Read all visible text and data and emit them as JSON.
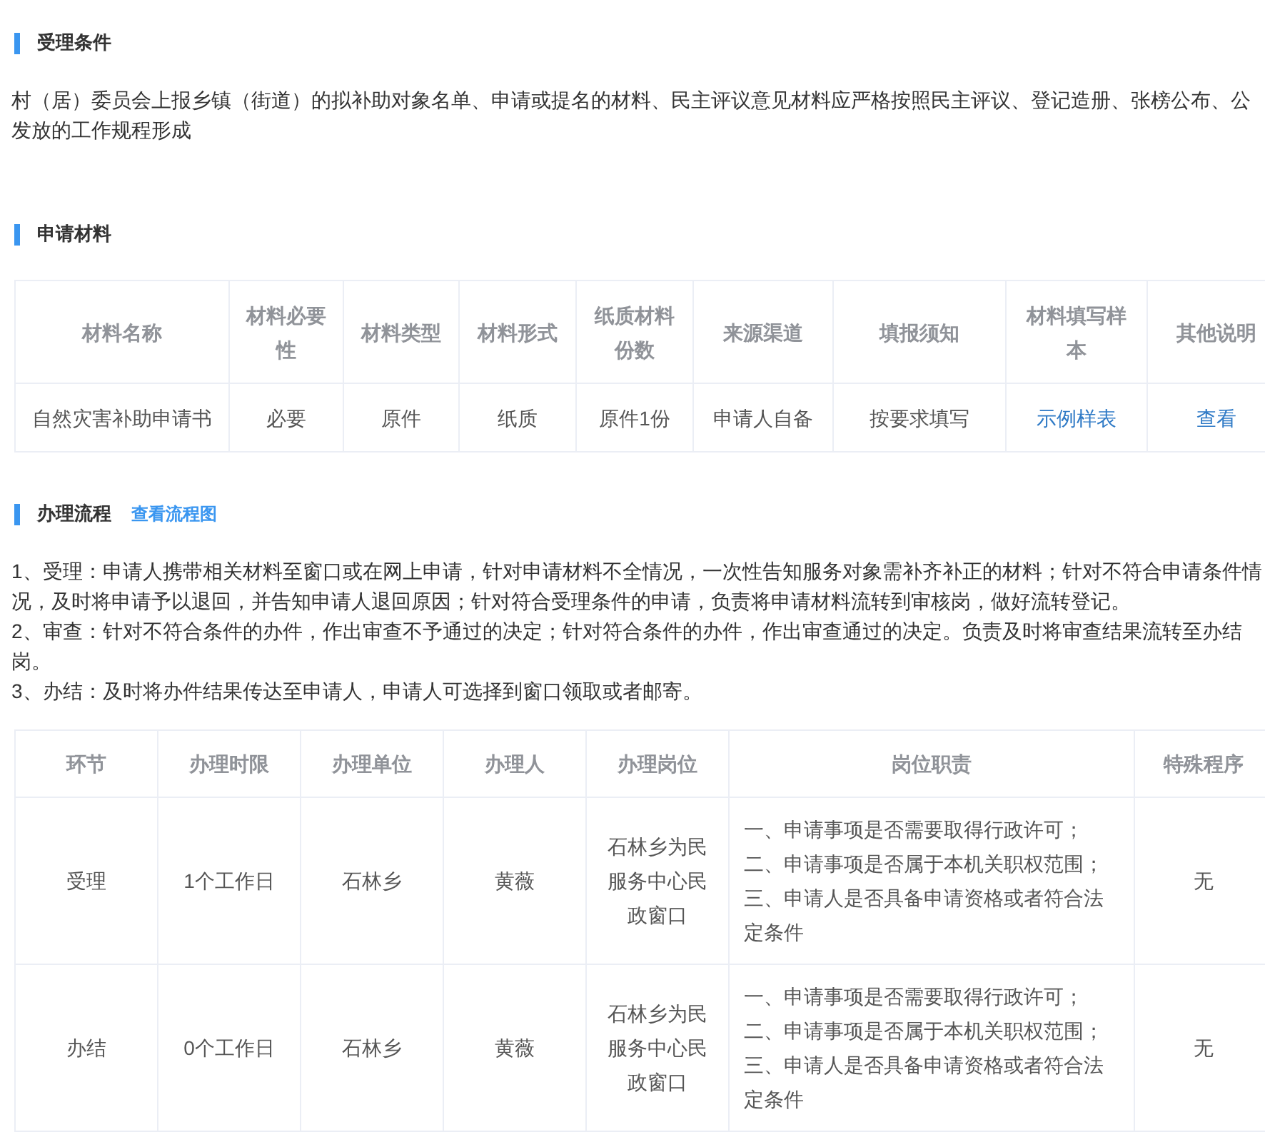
{
  "sections": [
    {
      "kind": "text",
      "title": "受理条件",
      "lines": [
        "村（居）委员会上报乡镇（街道）的拟补助对象名单、申请或提名的材料、民主评议意见材料应严格按照民主评议、登记造册、张榜公布、公",
        "发放的工作规程形成"
      ]
    },
    {
      "kind": "materials",
      "title": "申请材料",
      "columns": [
        "材料名称",
        "材料必要性",
        "材料类型",
        "材料形式",
        "纸质材料份数",
        "来源渠道",
        "填报须知",
        "材料填写样本",
        "其他说明"
      ],
      "rows": [
        [
          {
            "text": "自然灾害补助申请书",
            "link": false
          },
          {
            "text": "必要",
            "link": false
          },
          {
            "text": "原件",
            "link": false
          },
          {
            "text": "纸质",
            "link": false
          },
          {
            "text": "原件1份",
            "link": false
          },
          {
            "text": "申请人自备",
            "link": false
          },
          {
            "text": "按要求填写",
            "link": false
          },
          {
            "text": "示例样表",
            "link": true
          },
          {
            "text": "查看",
            "link": true
          }
        ]
      ]
    },
    {
      "kind": "process",
      "title": "办理流程",
      "link": "查看流程图",
      "paragraphs": [
        {
          "lines": [
            "1、受理：申请人携带相关材料至窗口或在网上申请，针对申请材料不全情况，一次性告知服务对象需补齐补正的材料；针对不符合申请条件情",
            "况，及时将申请予以退回，并告知申请人退回原因；针对符合受理条件的申请，负责将申请材料流转到审核岗，做好流转登记。"
          ]
        },
        {
          "lines": [
            "2、审查：针对不符合条件的办件，作出审查不予通过的决定；针对符合条件的办件，作出审查通过的决定。负责及时将审查结果流转至办结",
            "岗。"
          ]
        },
        {
          "lines": [
            "3、办结：及时将办件结果传达至申请人，申请人可选择到窗口领取或者邮寄。"
          ]
        }
      ],
      "columns": [
        "环节",
        "办理时限",
        "办理单位",
        "办理人",
        "办理岗位",
        "岗位职责",
        "特殊程序"
      ],
      "rows": [
        [
          "受理",
          "1个工作日",
          "石林乡",
          "黄薇",
          "石林乡为民服务中心民政窗口",
          [
            "一、申请事项是否需要取得行政许可；",
            "二、申请事项是否属于本机关职权范围；",
            "三、申请人是否具备申请资格或者符合法定条件"
          ],
          "无"
        ],
        [
          "办结",
          "0个工作日",
          "石林乡",
          "黄薇",
          "石林乡为民服务中心民政窗口",
          [
            "一、申请事项是否需要取得行政许可；",
            "二、申请事项是否属于本机关职权范围；",
            "三、申请人是否具备申请资格或者符合法定条件"
          ],
          "无"
        ]
      ]
    }
  ]
}
